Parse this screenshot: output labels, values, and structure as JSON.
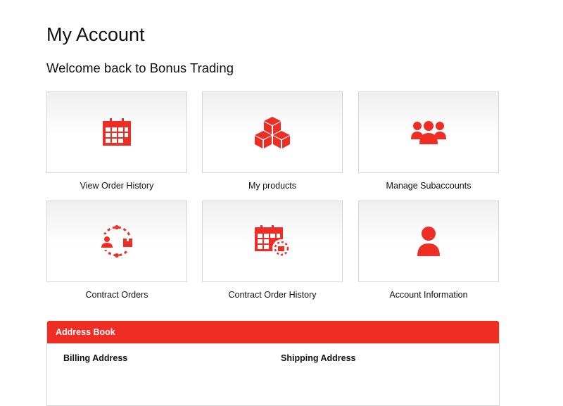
{
  "page": {
    "title": "My Account",
    "welcome": "Welcome back to Bonus Trading"
  },
  "colors": {
    "accent": "#ee2d24",
    "tile_border": "#d6d6d6",
    "text": "#111111"
  },
  "tiles": [
    {
      "label": "View Order History",
      "icon": "calendar-icon"
    },
    {
      "label": "My products",
      "icon": "cubes-icon"
    },
    {
      "label": "Manage Subaccounts",
      "icon": "users-group-icon"
    },
    {
      "label": "Contract Orders",
      "icon": "contract-cycle-icon"
    },
    {
      "label": "Contract Order History",
      "icon": "calendar-cycle-icon"
    },
    {
      "label": "Account Information",
      "icon": "user-icon"
    }
  ],
  "address_book": {
    "title": "Address Book",
    "billing_label": "Billing Address",
    "shipping_label": "Shipping Address"
  }
}
